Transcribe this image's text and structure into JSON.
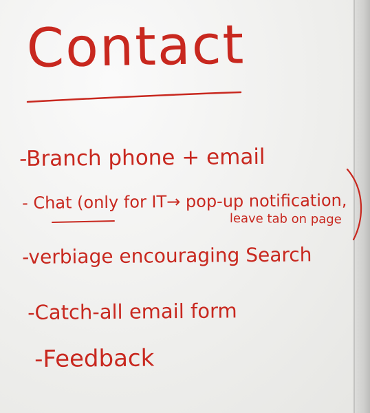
{
  "title": "Contact",
  "items": [
    "-Branch phone + email",
    "- Chat (only for IT→ pop-up notification,",
    "leave tab on page",
    "-verbiage encouraging Search",
    "-Catch-all email form",
    "-Feedback"
  ],
  "colors": {
    "marker": "#c8281f",
    "board": "#f3f3f1"
  }
}
